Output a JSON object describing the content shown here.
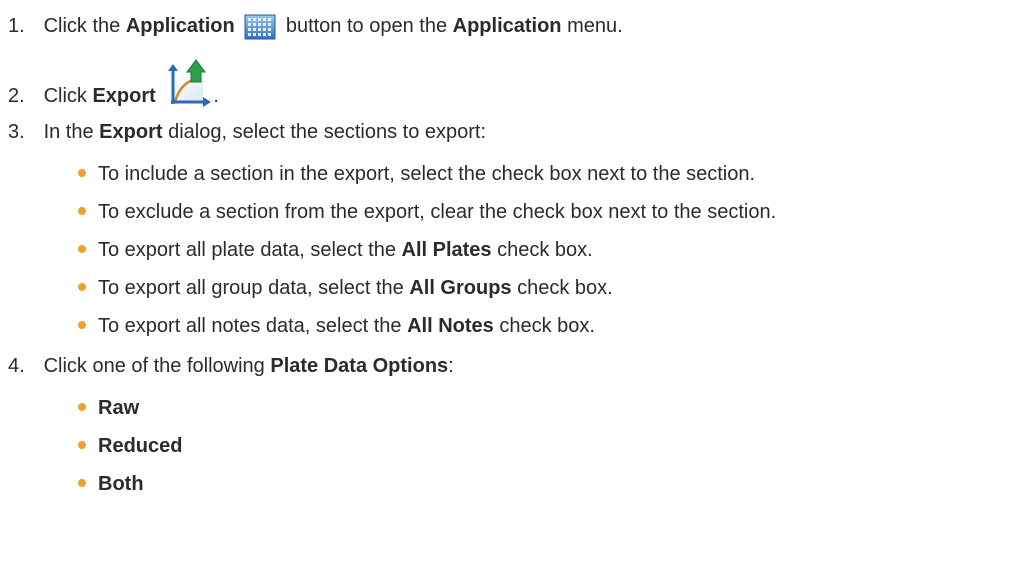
{
  "steps": [
    {
      "num": "1.",
      "parts": [
        "Click the ",
        "Application",
        " button to open the ",
        "Application",
        " menu."
      ],
      "icon": "application-grid-icon"
    },
    {
      "num": "2.",
      "parts": [
        "Click ",
        "Export",
        "."
      ],
      "icon": "export-chart-icon"
    },
    {
      "num": "3.",
      "parts": [
        "In the ",
        "Export",
        " dialog, select the sections to export:"
      ],
      "bullets": [
        {
          "parts": [
            "To include a section in the export, select the check box next to the section."
          ]
        },
        {
          "parts": [
            "To exclude a section from the export, clear the check box next to the section."
          ]
        },
        {
          "parts": [
            "To export all plate data, select the ",
            "All Plates",
            " check box."
          ]
        },
        {
          "parts": [
            "To export all group data, select the ",
            "All Groups",
            " check box."
          ]
        },
        {
          "parts": [
            "To export all notes data, select the ",
            "All Notes",
            " check box."
          ]
        }
      ]
    },
    {
      "num": "4.",
      "parts": [
        "Click one of the following ",
        "Plate Data Options",
        ":"
      ],
      "bullets": [
        {
          "parts": [
            "Raw"
          ]
        },
        {
          "parts": [
            "Reduced"
          ]
        },
        {
          "parts": [
            "Both"
          ]
        }
      ]
    }
  ],
  "colors": {
    "bullet": "#f0a030",
    "text": "#2b2b2b"
  }
}
